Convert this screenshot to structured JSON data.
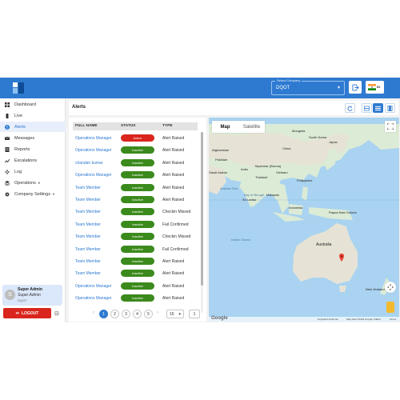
{
  "colors": {
    "brand": "#2e7ad1",
    "active_badge": "#d9251d",
    "inactive_badge": "#3b8a1c",
    "logout": "#d9251d"
  },
  "topbar": {
    "company_label": "Select Company",
    "company_value": "DQOT",
    "language_code": "IN"
  },
  "sidebar": {
    "items": [
      {
        "label": "Dashboard",
        "icon": "grid-icon"
      },
      {
        "label": "Live",
        "icon": "live-icon"
      },
      {
        "label": "Alerts",
        "icon": "alert-icon"
      },
      {
        "label": "Messages",
        "icon": "envelope-icon"
      },
      {
        "label": "Reports",
        "icon": "reports-icon"
      },
      {
        "label": "Escalations",
        "icon": "escalations-icon"
      },
      {
        "label": "Log",
        "icon": "log-icon"
      },
      {
        "label": "Operations",
        "icon": "operations-icon"
      },
      {
        "label": "Company Settings",
        "icon": "gear-icon"
      }
    ],
    "user": {
      "initial": "S",
      "name": "Super Admin",
      "role": "Super Admin",
      "company": "DQOT"
    },
    "logout_label": "LOGOUT"
  },
  "page": {
    "title": "Alerts"
  },
  "table": {
    "headers": [
      "FULL NAME",
      "STATUS",
      "TYPE"
    ],
    "rows": [
      {
        "name": "Operations Manager",
        "status": "Active",
        "type": "Alert Raised"
      },
      {
        "name": "Operations Manager",
        "status": "Inactive",
        "type": "Alert Raised"
      },
      {
        "name": "chandan kumar",
        "status": "Inactive",
        "type": "Alert Raised"
      },
      {
        "name": "Operations Manager",
        "status": "Inactive",
        "type": "Alert Raised"
      },
      {
        "name": "Team Member",
        "status": "Inactive",
        "type": "Alert Raised"
      },
      {
        "name": "Team Member",
        "status": "Inactive",
        "type": "Alert Raised"
      },
      {
        "name": "Team Member",
        "status": "Inactive",
        "type": "Checkin Missed"
      },
      {
        "name": "Team Member",
        "status": "Inactive",
        "type": "Fail Confirmed"
      },
      {
        "name": "Team Member",
        "status": "Inactive",
        "type": "Checkin Missed"
      },
      {
        "name": "Team Member",
        "status": "Inactive",
        "type": "Fail Confirmed"
      },
      {
        "name": "Team Member",
        "status": "Inactive",
        "type": "Alert Raised"
      },
      {
        "name": "Team Member",
        "status": "Inactive",
        "type": "Alert Raised"
      },
      {
        "name": "Operations Manager",
        "status": "Inactive",
        "type": "Alert Raised"
      },
      {
        "name": "Operations Manager",
        "status": "Inactive",
        "type": "Alert Raised"
      }
    ]
  },
  "pagination": {
    "pages": [
      "1",
      "2",
      "3",
      "4",
      "5"
    ],
    "current": "1",
    "page_size": "15",
    "goto": "1"
  },
  "map": {
    "tabs": [
      "Map",
      "Satellite"
    ],
    "labels": [
      {
        "text": "Kazakhstan"
      },
      {
        "text": "Mongolia"
      },
      {
        "text": "China"
      },
      {
        "text": "Afghanistan"
      },
      {
        "text": "Pakistan"
      },
      {
        "text": "India"
      },
      {
        "text": "Japan"
      },
      {
        "text": "South Korea"
      },
      {
        "text": "Myanmar (Burma)"
      },
      {
        "text": "Thailand"
      },
      {
        "text": "Vietnam"
      },
      {
        "text": "Philippines"
      },
      {
        "text": "Malaysia"
      },
      {
        "text": "Indonesia"
      },
      {
        "text": "Papua New Guinea"
      },
      {
        "text": "Australia"
      },
      {
        "text": "New Zealand"
      },
      {
        "text": "Arabian Sea"
      },
      {
        "text": "Bay of Bengal"
      },
      {
        "text": "Indian Ocean"
      },
      {
        "text": "Sri Lanka"
      },
      {
        "text": "Saudi Arabia"
      }
    ],
    "footer": {
      "google": "Google",
      "shortcuts": "Keyboard shortcuts",
      "copyright": "Map data ©2023 Google, INEGI",
      "terms": "Terms"
    }
  }
}
